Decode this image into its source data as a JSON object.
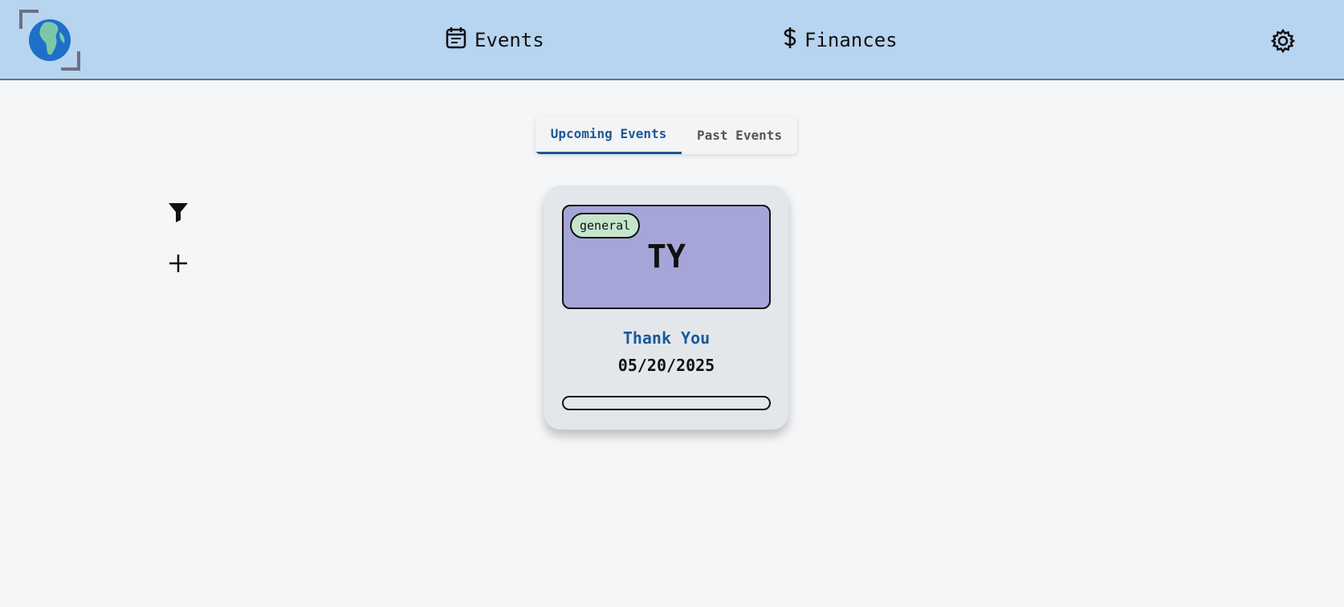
{
  "header": {
    "logo_icon": "globe-africa-icon",
    "nav": [
      {
        "label": "Events",
        "icon": "calendar-icon"
      },
      {
        "label": "Finances",
        "icon": "dollar-icon"
      }
    ],
    "settings_icon": "gear-icon"
  },
  "tabs": [
    {
      "label": "Upcoming Events",
      "active": true
    },
    {
      "label": "Past Events",
      "active": false
    }
  ],
  "tools": {
    "filter_icon": "filter-icon",
    "add_icon": "plus-icon"
  },
  "event_card": {
    "tag": "general",
    "initials": "TY",
    "title": "Thank You",
    "date": "05/20/2025",
    "banner_color": "#a5a5d8",
    "tag_color": "#c5e6cc"
  },
  "colors": {
    "header_bg": "#b7d4f0",
    "accent": "#1b5a96",
    "page_bg": "#f5f6f8"
  }
}
